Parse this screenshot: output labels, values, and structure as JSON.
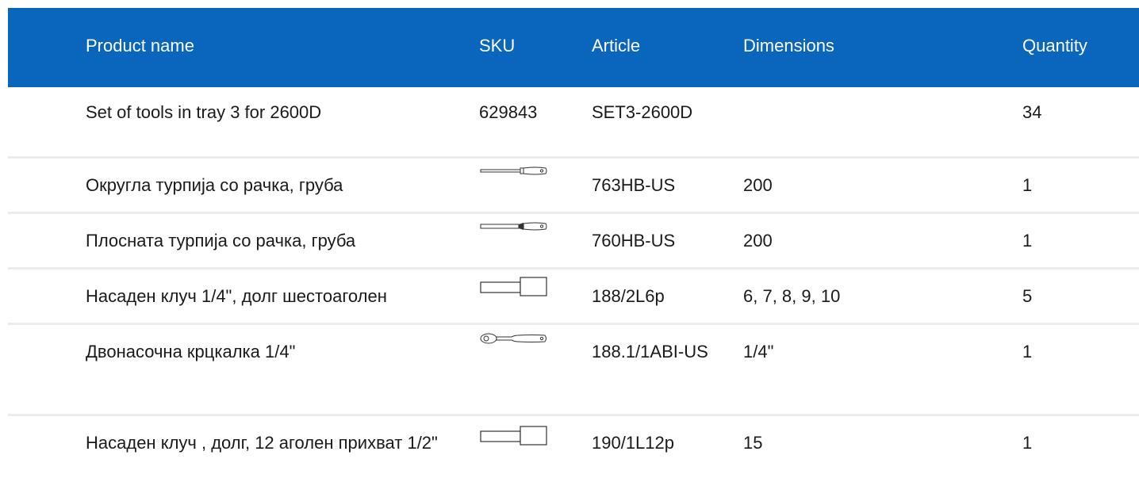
{
  "table": {
    "columns": {
      "name": "Product name",
      "sku": "SKU",
      "article": "Article",
      "dimensions": "Dimensions",
      "quantity": "Quantity"
    },
    "rows": [
      {
        "name": "Set of tools in tray 3 for 2600D",
        "sku": "629843",
        "sku_icon": "",
        "article": "SET3-2600D",
        "dimensions": "",
        "quantity": "34"
      },
      {
        "name": "Округла турпија со рачка, груба",
        "sku": "",
        "sku_icon": "round-file-icon",
        "article": "763HB-US",
        "dimensions": "200",
        "quantity": "1"
      },
      {
        "name": "Плосната турпија со рачка, груба",
        "sku": "",
        "sku_icon": "flat-file-icon",
        "article": "760HB-US",
        "dimensions": "200",
        "quantity": "1"
      },
      {
        "name": "Насаден клуч 1/4\", долг шестоаголен",
        "sku": "",
        "sku_icon": "long-socket-icon",
        "article": "188/2L6p",
        "dimensions": "6, 7, 8, 9, 10",
        "quantity": "5"
      },
      {
        "name": "Двонасочна крцкалка 1/4\"",
        "sku": "",
        "sku_icon": "ratchet-icon",
        "article": "188.1/1ABI-US",
        "dimensions": "1/4\"",
        "quantity": "1"
      },
      {
        "name": "Насаден клуч , долг, 12 аголен прихват 1/2\"",
        "sku": "",
        "sku_icon": "long-socket-icon",
        "article": "190/1L12p",
        "dimensions": "15",
        "quantity": "1"
      }
    ]
  },
  "colors": {
    "header_bg": "#0a66bd",
    "header_text": "#ffffff",
    "divider": "#ececec"
  }
}
